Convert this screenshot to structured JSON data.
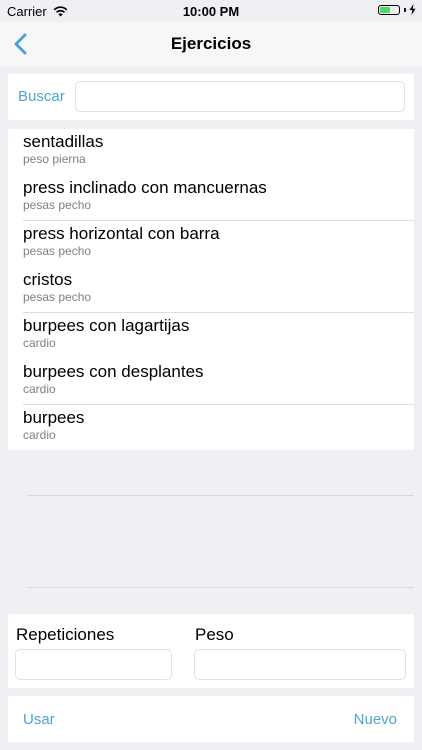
{
  "status_bar": {
    "carrier": "Carrier",
    "time": "10:00 PM",
    "battery_level": 0.55,
    "icons": [
      "wifi-icon",
      "battery-icon",
      "charging-bolt-icon"
    ]
  },
  "nav": {
    "title": "Ejercicios",
    "back_icon": "chevron-left-icon",
    "accent_color": "#4fa3d1"
  },
  "search": {
    "label": "Buscar",
    "value": "",
    "placeholder": ""
  },
  "exercises": [
    {
      "title": "sentadillas",
      "subtitle": "peso pierna"
    },
    {
      "title": "press inclinado con mancuernas",
      "subtitle": "pesas pecho"
    },
    {
      "title": "press horizontal con barra",
      "subtitle": "pesas pecho"
    },
    {
      "title": "cristos",
      "subtitle": "pesas pecho"
    },
    {
      "title": "burpees con lagartijas",
      "subtitle": "cardio"
    },
    {
      "title": "burpees con desplantes",
      "subtitle": "cardio"
    },
    {
      "title": "burpees",
      "subtitle": "cardio"
    }
  ],
  "form": {
    "repetitions_label": "Repeticiones",
    "repetitions_value": "",
    "weight_label": "Peso",
    "weight_value": ""
  },
  "actions": {
    "use_label": "Usar",
    "new_label": "Nuevo"
  },
  "colors": {
    "background": "#efeff4",
    "accent": "#4fa3d1",
    "subtitle": "#808080"
  }
}
